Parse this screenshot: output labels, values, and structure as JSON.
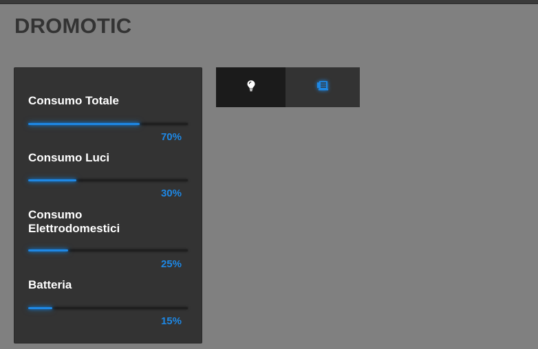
{
  "app": {
    "title": "DROMOTIC"
  },
  "meters": [
    {
      "label": "Consumo Totale",
      "value": 70,
      "display": "70%"
    },
    {
      "label": "Consumo Luci",
      "value": 30,
      "display": "30%"
    },
    {
      "label": "Consumo Elettrodomestici",
      "value": 25,
      "display": "25%"
    },
    {
      "label": "Batteria",
      "value": 15,
      "display": "15%"
    }
  ],
  "tabs": [
    {
      "name": "lights",
      "icon": "lightbulb-icon",
      "active": true
    },
    {
      "name": "appliances",
      "icon": "appliance-icon",
      "active": false
    }
  ],
  "colors": {
    "accent": "#1e88e5",
    "panel": "#333333",
    "background": "#808080"
  }
}
